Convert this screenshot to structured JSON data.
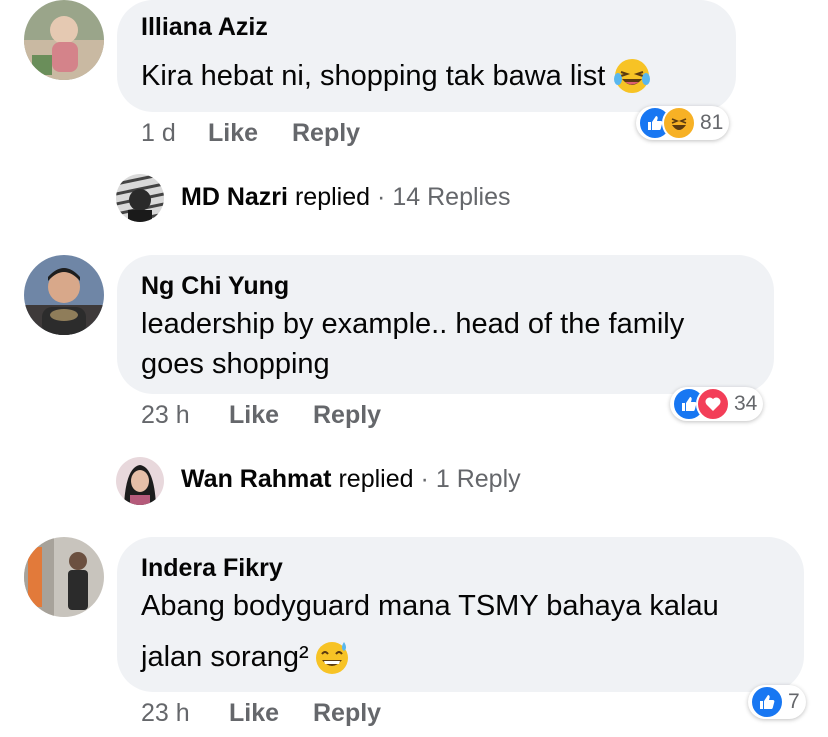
{
  "comments": [
    {
      "author": "Illiana Aziz",
      "text": "Kira hebat ni, shopping tak bawa list",
      "time": "1 d",
      "like_label": "Like",
      "reply_label": "Reply",
      "reaction_count": "81",
      "reactions": [
        "like-icon",
        "haha-icon"
      ],
      "replies": {
        "name": "MD Nazri",
        "verb": "replied",
        "count": "14 Replies"
      }
    },
    {
      "author": "Ng Chi Yung",
      "text_line1": "leadership by example.. head of the family",
      "text_line2": "goes shopping",
      "time": "23 h",
      "like_label": "Like",
      "reply_label": "Reply",
      "reaction_count": "34",
      "reactions": [
        "like-icon",
        "love-icon"
      ],
      "replies": {
        "name": "Wan Rahmat",
        "verb": "replied",
        "count": "1 Reply"
      }
    },
    {
      "author": "Indera Fikry",
      "text_line1": "Abang bodyguard mana TSMY bahaya kalau",
      "text_line2": "jalan sorang²",
      "time": "23 h",
      "like_label": "Like",
      "reply_label": "Reply",
      "reaction_count": "7",
      "reactions": [
        "like-icon"
      ]
    }
  ],
  "separator": "·",
  "colors": {
    "bubble": "#f0f2f5",
    "like_blue": "#1877f2",
    "love_red": "#f33e58",
    "haha_yellow": "#f7b125",
    "meta_gray": "#65676b"
  }
}
